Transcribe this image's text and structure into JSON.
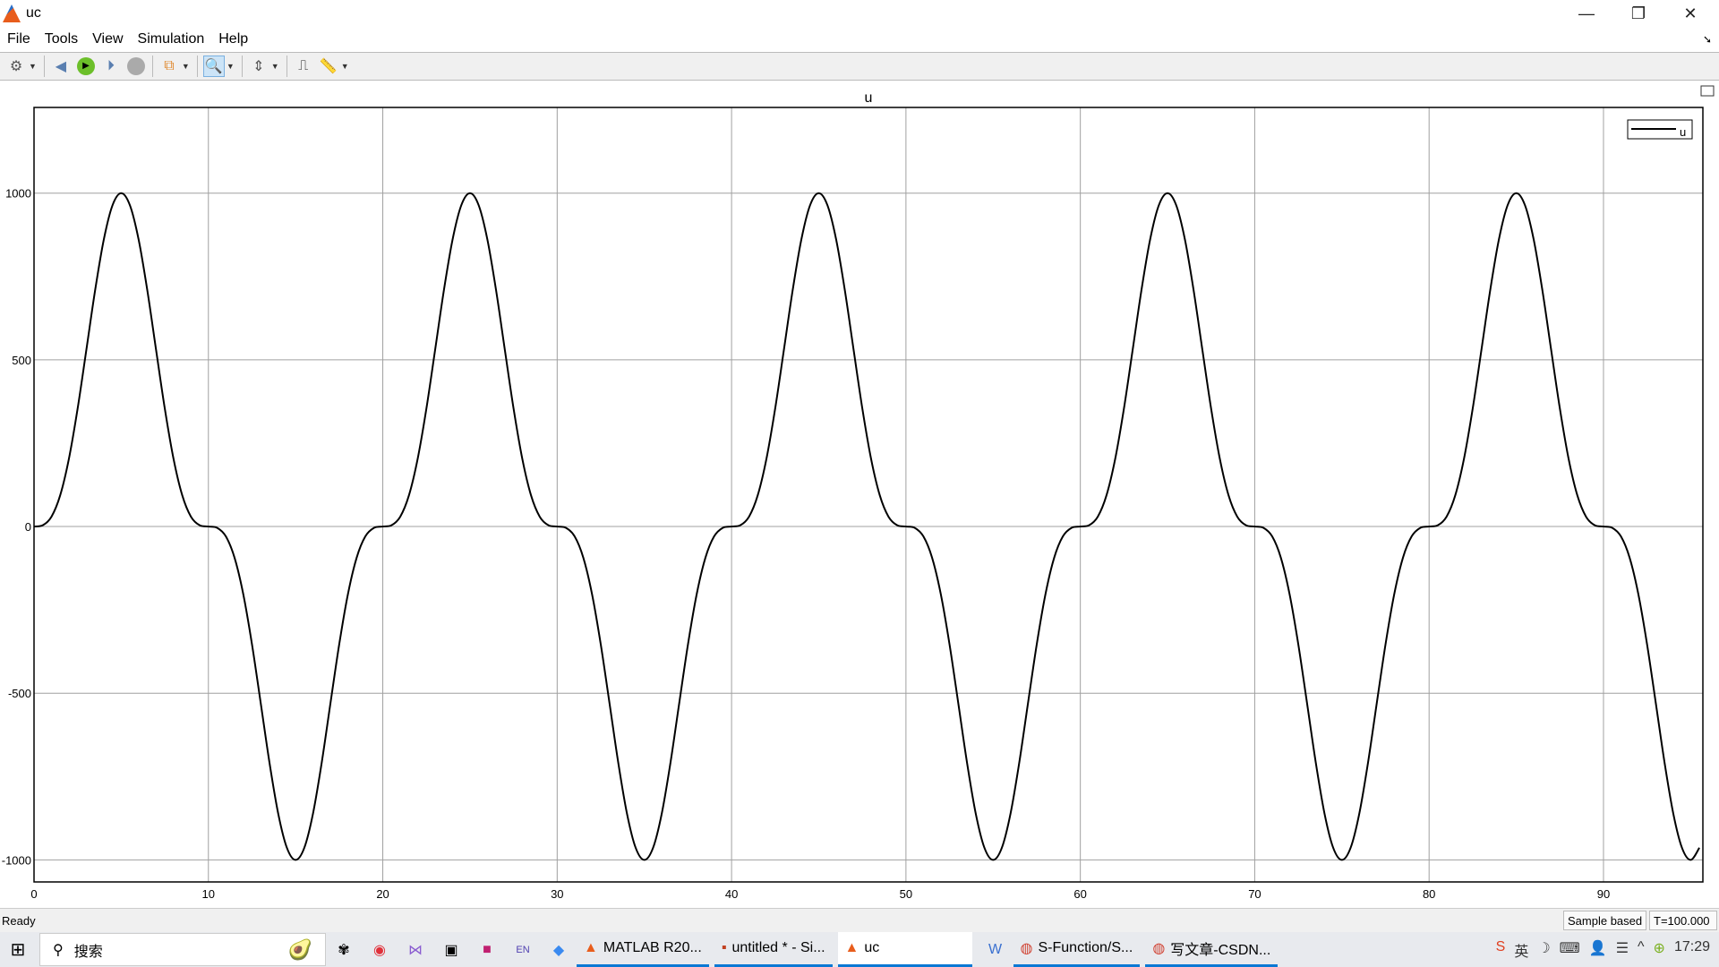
{
  "window": {
    "title": "uc",
    "minimize": "—",
    "restore": "❐",
    "close": "✕"
  },
  "menu": [
    "File",
    "Tools",
    "View",
    "Simulation",
    "Help"
  ],
  "toolbar": {
    "icons": [
      "gear-icon",
      "step-back-icon",
      "run-icon",
      "step-forward-icon",
      "stop-icon",
      "signal-selector-icon",
      "zoom-in-icon",
      "autoscale-icon",
      "triggers-icon",
      "measurements-icon"
    ]
  },
  "plot": {
    "title": "u",
    "legend": "u",
    "colors": {
      "line": "#000000",
      "grid": "#a0a0a0"
    }
  },
  "chart_data": {
    "type": "line",
    "title": "u",
    "xlabel": "",
    "ylabel": "",
    "xlim": [
      0,
      95.7
    ],
    "ylim": [
      -1066,
      1257
    ],
    "grid": true,
    "legend_position": "top-right",
    "xticks": [
      0,
      10,
      20,
      30,
      40,
      50,
      60,
      70,
      80,
      90
    ],
    "yticks": [
      -1000,
      -500,
      0,
      500,
      1000
    ],
    "series": [
      {
        "name": "u",
        "x_start": 0,
        "x_step": 0.5,
        "y": [
          0,
          3.8,
          29.5,
          93.6,
          203.1,
          353.6,
          529.5,
          707.4,
          860.3,
          963.5,
          1000,
          963.5,
          860.3,
          707.4,
          529.5,
          353.6,
          203.1,
          93.6,
          29.5,
          3.8,
          0,
          -3.8,
          -29.5,
          -93.6,
          -203.1,
          -353.6,
          -529.5,
          -707.4,
          -860.3,
          -963.5,
          -1000,
          -963.5,
          -860.3,
          -707.4,
          -529.5,
          -353.6,
          -203.1,
          -93.6,
          -29.5,
          -3.8,
          0,
          3.8,
          29.5,
          93.6,
          203.1,
          353.6,
          529.5,
          707.4,
          860.3,
          963.5,
          1000,
          963.5,
          860.3,
          707.4,
          529.5,
          353.6,
          203.1,
          93.6,
          29.5,
          3.8,
          0,
          -3.8,
          -29.5,
          -93.6,
          -203.1,
          -353.6,
          -529.5,
          -707.4,
          -860.3,
          -963.5,
          -1000,
          -963.5,
          -860.3,
          -707.4,
          -529.5,
          -353.6,
          -203.1,
          -93.6,
          -29.5,
          -3.8,
          0,
          3.8,
          29.5,
          93.6,
          203.1,
          353.6,
          529.5,
          707.4,
          860.3,
          963.5,
          1000,
          963.5,
          860.3,
          707.4,
          529.5,
          353.6,
          203.1,
          93.6,
          29.5,
          3.8,
          0,
          -3.8,
          -29.5,
          -93.6,
          -203.1,
          -353.6,
          -529.5,
          -707.4,
          -860.3,
          -963.5,
          -1000,
          -963.5,
          -860.3,
          -707.4,
          -529.5,
          -353.6,
          -203.1,
          -93.6,
          -29.5,
          -3.8,
          0,
          3.8,
          29.5,
          93.6,
          203.1,
          353.6,
          529.5,
          707.4,
          860.3,
          963.5,
          1000,
          963.5,
          860.3,
          707.4,
          529.5,
          353.6,
          203.1,
          93.6,
          29.5,
          3.8,
          0,
          -3.8,
          -29.5,
          -93.6,
          -203.1,
          -353.6,
          -529.5,
          -707.4,
          -860.3,
          -963.5,
          -1000,
          -963.5,
          -860.3,
          -707.4,
          -529.5,
          -353.6,
          -203.1,
          -93.6,
          -29.5,
          -3.8,
          0,
          3.8,
          29.5,
          93.6,
          203.1,
          353.6,
          529.5,
          707.4,
          860.3,
          963.5,
          1000,
          963.5,
          860.3,
          707.4,
          529.5,
          353.6,
          203.1,
          93.6,
          29.5,
          3.8,
          0,
          -3.8,
          -29.5,
          -93.6,
          -203.1,
          -353.6,
          -529.5,
          -707.4,
          -860.3,
          -963.5,
          -1000,
          -963.5
        ]
      }
    ]
  },
  "status": {
    "ready": "Ready",
    "mode": "Sample based",
    "time": "T=100.000"
  },
  "taskbar": {
    "search": "搜索",
    "tasks": [
      "MATLAB R20...",
      "untitled * - Si...",
      "uc",
      "S-Function/S...",
      "写文章-CSDN..."
    ],
    "tray": [
      "英",
      "17:29"
    ]
  }
}
